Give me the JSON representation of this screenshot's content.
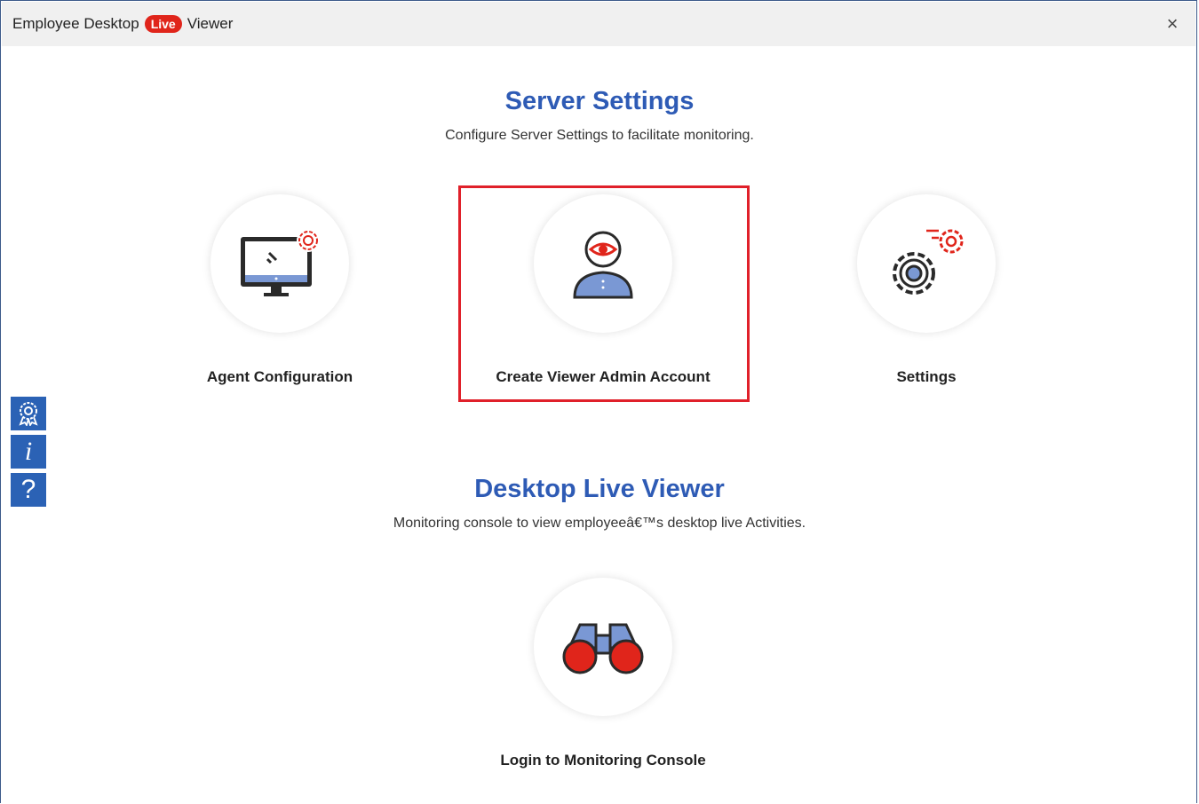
{
  "window": {
    "title_prefix": "Employee Desktop",
    "title_badge": "Live",
    "title_suffix": "Viewer",
    "close_glyph": "×"
  },
  "server_settings": {
    "title": "Server Settings",
    "subtitle": "Configure Server Settings to facilitate monitoring.",
    "tiles": [
      {
        "label": "Agent Configuration",
        "icon": "monitor-gear-icon"
      },
      {
        "label": "Create Viewer Admin Account",
        "icon": "user-eye-icon"
      },
      {
        "label": "Settings",
        "icon": "gears-icon"
      }
    ]
  },
  "desktop_live_viewer": {
    "title": "Desktop Live Viewer",
    "subtitle": "Monitoring console to view employeeâ€™s desktop live Activities.",
    "tiles": [
      {
        "label": "Login to Monitoring Console",
        "icon": "binoculars-icon"
      }
    ]
  },
  "side_toolbar": {
    "items": [
      {
        "icon": "award-icon",
        "glyph": ""
      },
      {
        "icon": "info-icon",
        "glyph": "i"
      },
      {
        "icon": "help-icon",
        "glyph": "?"
      }
    ]
  },
  "colors": {
    "accent_blue": "#2e5bb5",
    "accent_red": "#e0251b",
    "highlight_red": "#e0202a",
    "sidebar_blue": "#2b62b5"
  }
}
